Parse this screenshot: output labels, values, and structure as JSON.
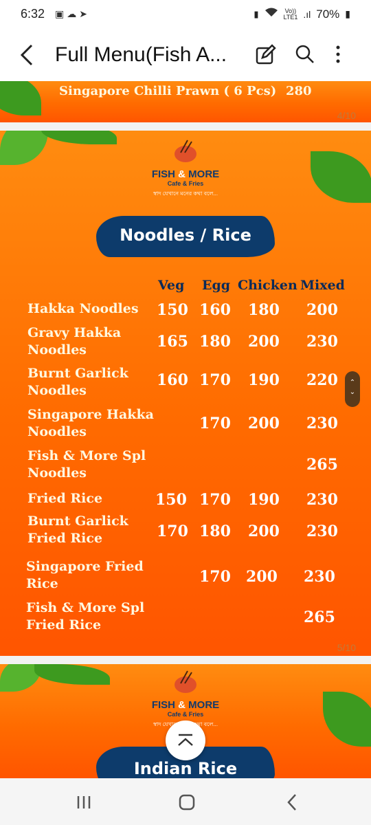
{
  "status_bar": {
    "time": "6:32",
    "left_icons": [
      "gallery-icon",
      "cloud-icon",
      "telegram-icon"
    ],
    "volte_top": "Vo))",
    "volte_bottom": "LTE1",
    "battery": "70%"
  },
  "header": {
    "title": "Full Menu(Fish A...",
    "icons": [
      "edit-icon",
      "search-icon",
      "more-vert-icon"
    ]
  },
  "prev_page": {
    "item": "Singapore Chilli Prawn ( 6 Pcs)",
    "price": "280",
    "page_num": "4/10"
  },
  "menu_page": {
    "brand": "FISH",
    "brand_amp": "&",
    "brand_rest": "MORE",
    "brand_sub": "Cafe & Fries",
    "tagline": "স্বাদ যেখানে মনের কথা বলে...",
    "section_title": "Noodles / Rice",
    "columns": [
      "Veg",
      "Egg",
      "Chicken",
      "Mixed"
    ],
    "items": [
      {
        "name_lines": [
          "Hakka Noodles"
        ],
        "veg": "150",
        "egg": "160",
        "chicken": "180",
        "mixed": "200"
      },
      {
        "name_lines": [
          "Gravy Hakka",
          "Noodles"
        ],
        "veg": "165",
        "egg": "180",
        "chicken": "200",
        "mixed": "230"
      },
      {
        "name_lines": [
          "Burnt Garlick",
          "Noodles"
        ],
        "veg": "160",
        "egg": "170",
        "chicken": "190",
        "mixed": "220"
      },
      {
        "name_lines": [
          "Singapore Hakka",
          "Noodles"
        ],
        "veg": "",
        "egg": "170",
        "chicken": "200",
        "mixed": "230"
      },
      {
        "name_lines": [
          "Fish & More Spl",
          "Noodles"
        ],
        "veg": "",
        "egg": "",
        "chicken": "",
        "mixed": "265"
      },
      {
        "name_lines": [
          "Fried Rice"
        ],
        "veg": "150",
        "egg": "170",
        "chicken": "190",
        "mixed": "230"
      },
      {
        "name_lines": [
          "Burnt Garlick",
          "Fried Rice"
        ],
        "veg": "170",
        "egg": "180",
        "chicken": "200",
        "mixed": "230"
      },
      {
        "name_lines": [
          "Singapore Fried",
          "Rice"
        ],
        "veg": "",
        "egg": "170",
        "chicken": "200",
        "mixed": "230"
      },
      {
        "name_lines": [
          "Fish & More Spl",
          "Fried Rice"
        ],
        "veg": "",
        "egg": "",
        "chicken": "",
        "mixed": "265"
      }
    ],
    "page_num": "5/10"
  },
  "next_page": {
    "brand": "FISH",
    "brand_amp": "&",
    "brand_rest": "MORE",
    "brand_sub": "Cafe & Fries",
    "tagline": "স্বাদ যেখানে মনের কথা বলে...",
    "section_title": "Indian Rice"
  },
  "scroll_handle": {
    "up": "⌃",
    "down": "⌄"
  },
  "fab": {
    "icon": "scroll-to-top-icon"
  },
  "nav_bar": {
    "icons": [
      "recent-apps-icon",
      "home-icon",
      "back-icon"
    ]
  }
}
